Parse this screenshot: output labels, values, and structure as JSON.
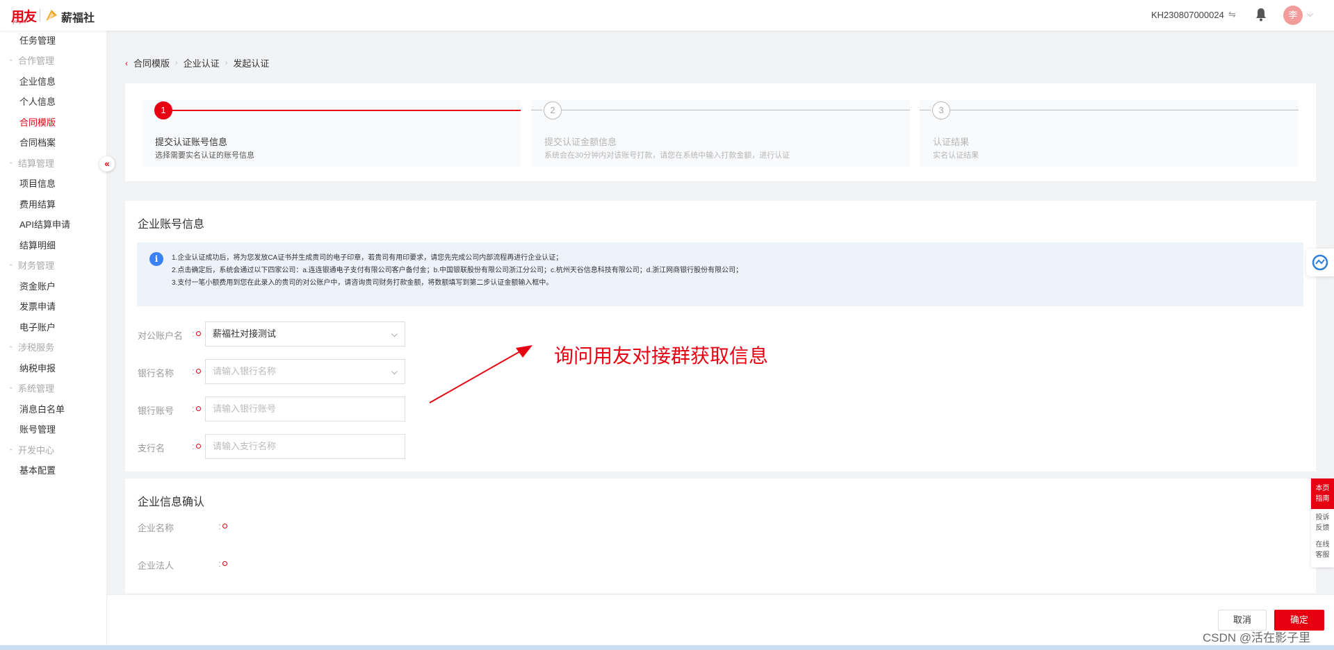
{
  "header": {
    "brand_main": "用友",
    "brand_sub": "yonyou",
    "brand_product": "薪福社",
    "account_id": "KH230807000024",
    "avatar_initial": "李"
  },
  "sidebar": {
    "items": [
      {
        "label": "任务管理",
        "type": "item"
      },
      {
        "label": "合作管理",
        "type": "group"
      },
      {
        "label": "企业信息",
        "type": "item"
      },
      {
        "label": "个人信息",
        "type": "item"
      },
      {
        "label": "合同模版",
        "type": "item",
        "active": true
      },
      {
        "label": "合同档案",
        "type": "item"
      },
      {
        "label": "结算管理",
        "type": "group"
      },
      {
        "label": "项目信息",
        "type": "item"
      },
      {
        "label": "费用结算",
        "type": "item"
      },
      {
        "label": "API结算申请",
        "type": "item"
      },
      {
        "label": "结算明细",
        "type": "item"
      },
      {
        "label": "财务管理",
        "type": "group"
      },
      {
        "label": "资金账户",
        "type": "item"
      },
      {
        "label": "发票申请",
        "type": "item"
      },
      {
        "label": "电子账户",
        "type": "item"
      },
      {
        "label": "涉税服务",
        "type": "group"
      },
      {
        "label": "纳税申报",
        "type": "item"
      },
      {
        "label": "系统管理",
        "type": "group"
      },
      {
        "label": "消息白名单",
        "type": "item"
      },
      {
        "label": "账号管理",
        "type": "item"
      },
      {
        "label": "开发中心",
        "type": "group"
      },
      {
        "label": "基本配置",
        "type": "item"
      }
    ],
    "collapse_symbol": "«"
  },
  "breadcrumb": [
    "合同模版",
    "企业认证",
    "发起认证"
  ],
  "steps": [
    {
      "number": "1",
      "title": "提交认证账号信息",
      "desc": "选择需要实名认证的账号信息",
      "status": "active"
    },
    {
      "number": "2",
      "title": "提交认证金额信息",
      "desc": "系统会在30分钟内对该账号打款，请您在系统中输入打款金额，进行认证",
      "status": "inactive"
    },
    {
      "number": "3",
      "title": "认证结果",
      "desc": "实名认证结果",
      "status": "inactive"
    }
  ],
  "account_section": {
    "title": "企业账号信息",
    "notice_lines": [
      "1.企业认证成功后，将为您发放CA证书并生成贵司的电子印章，若贵司有用印要求，请您先完成公司内部流程再进行企业认证；",
      "2.点击确定后，系统会通过以下四家公司：a.连连银通电子支付有限公司客户备付金；b.中国银联股份有限公司浙江分公司；c.杭州天谷信息科技有限公司；d.浙江网商银行股份有限公司；",
      "3.支付一笔小额费用到您在此录入的贵司的对公账户中，请咨询贵司财务打款金额，将数额填写到第二步认证金额输入框中。"
    ],
    "fields": {
      "account_name": {
        "label": "对公账户名",
        "value": "薪福社对接测试"
      },
      "bank_name": {
        "label": "银行名称",
        "placeholder": "请输入银行名称"
      },
      "bank_account": {
        "label": "银行账号",
        "placeholder": "请输入银行账号"
      },
      "branch_name": {
        "label": "支行名",
        "placeholder": "请输入支行名称"
      }
    }
  },
  "annotation": "询问用友对接群获取信息",
  "company_section": {
    "title": "企业信息确认",
    "fields": [
      {
        "label": "企业名称"
      },
      {
        "label": "企业法人"
      }
    ]
  },
  "side_guide": {
    "top": [
      "本页",
      "指南"
    ],
    "items": [
      [
        "投诉",
        "反馈"
      ],
      [
        "在线",
        "客服"
      ]
    ]
  },
  "footer": {
    "cancel": "取消",
    "confirm": "确定"
  },
  "watermark": "CSDN @活在影子里",
  "colors": {
    "brand": "#e60012",
    "info_bg": "#eef3fb",
    "info_icon": "#3b82f6"
  }
}
